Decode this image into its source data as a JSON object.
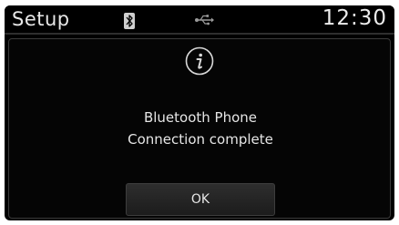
{
  "status_bar": {
    "title": "Setup",
    "clock": "12:30",
    "icons": [
      "bluetooth-icon",
      "usb-icon"
    ]
  },
  "dialog": {
    "icon": "info-icon",
    "message_line1": "Bluetooth Phone",
    "message_line2": "Connection complete",
    "ok_label": "OK"
  },
  "colors": {
    "background": "#000000",
    "text": "#e6e6e6",
    "button": "#262626"
  }
}
